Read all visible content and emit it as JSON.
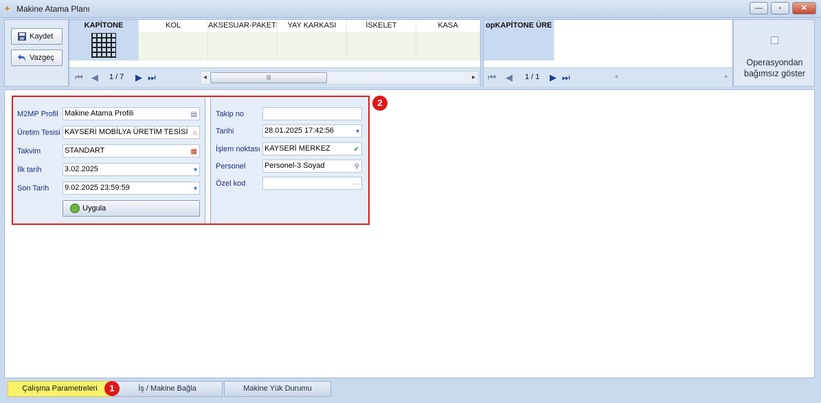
{
  "window": {
    "title": "Makine Atama Planı",
    "controls": [
      "minimize",
      "maximize",
      "close"
    ]
  },
  "toolbar": {
    "save_label": "Kaydet",
    "cancel_label": "Vazgeç"
  },
  "category_grid": {
    "columns": [
      "KAPİTONE",
      "KOL",
      "AKSESUAR-PAKETLE",
      "YAY KARKASI",
      "İSKELET",
      "KASA"
    ],
    "selected": "KAPİTONE",
    "pager": "1 / 7"
  },
  "operation_grid": {
    "columns": [
      "opKAPİTONE ÜRE"
    ],
    "pager": "1 / 1"
  },
  "independent_toggle": {
    "label": "Operasyondan bağımsız göster",
    "checked": false
  },
  "params": {
    "profile_label": "M2MP Profil",
    "profile_value": "Makine Atama Profili",
    "facility_label": "Üretim Tesisi",
    "facility_value": "KAYSERİ MOBİLYA ÜRETİM TESİSİ",
    "calendar_label": "Takvim",
    "calendar_value": "STANDART",
    "start_label": "İlk tarih",
    "start_value": "3.02.2025",
    "end_label": "Son Tarih",
    "end_value": "9.02.2025 23:59:59",
    "apply_label": "Uygula"
  },
  "tracking": {
    "no_label": "Takip no",
    "no_value": "",
    "date_label": "Tarihi",
    "date_value": "28.01.2025 17:42:56",
    "point_label": "İşlem noktası",
    "point_value": "KAYSERİ MERKEZ",
    "personnel_label": "Personel",
    "personnel_value": "Personel-3 Soyad",
    "code_label": "Özel kod",
    "code_value": ""
  },
  "annotations": {
    "badge_1": "1",
    "badge_2": "2"
  },
  "tabs": [
    "Çalışma Parametreleri",
    "İş / Makine Bağla",
    "Makine Yük Durumu"
  ],
  "colors": {
    "active_tab": "#f7f26a",
    "highlight_frame": "#d62020",
    "badge": "#e01818",
    "label": "#1a2e78"
  }
}
